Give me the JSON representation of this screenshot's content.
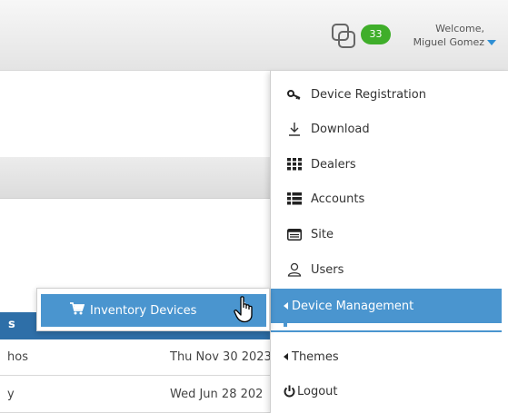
{
  "header": {
    "notification_count": "33",
    "welcome_label": "Welcome,",
    "user_name": "Miguel Gomez"
  },
  "background": {
    "table_header_fragment": "s",
    "rows": [
      {
        "name": "hos",
        "date": "Thu Nov 30 2023"
      },
      {
        "name": "y",
        "date": "Wed Jun 28 202"
      }
    ]
  },
  "menu": {
    "items": [
      {
        "label": "Device Registration",
        "icon": "key-icon"
      },
      {
        "label": "Download",
        "icon": "download-icon"
      },
      {
        "label": "Dealers",
        "icon": "grid-icon"
      },
      {
        "label": "Accounts",
        "icon": "list-icon"
      },
      {
        "label": "Site",
        "icon": "site-icon"
      },
      {
        "label": "Users",
        "icon": "user-icon"
      },
      {
        "label": "Device Management",
        "icon": "caret-left-icon"
      },
      {
        "label": "Themes",
        "icon": "caret-left-icon"
      },
      {
        "label": "Logout",
        "icon": "power-icon"
      }
    ]
  },
  "submenu": {
    "items": [
      {
        "label": "Inventory Devices",
        "icon": "cart-icon"
      }
    ]
  },
  "colors": {
    "accent": "#4a95cf",
    "badge": "#3fae2a",
    "table_header": "#2e6fa8"
  }
}
